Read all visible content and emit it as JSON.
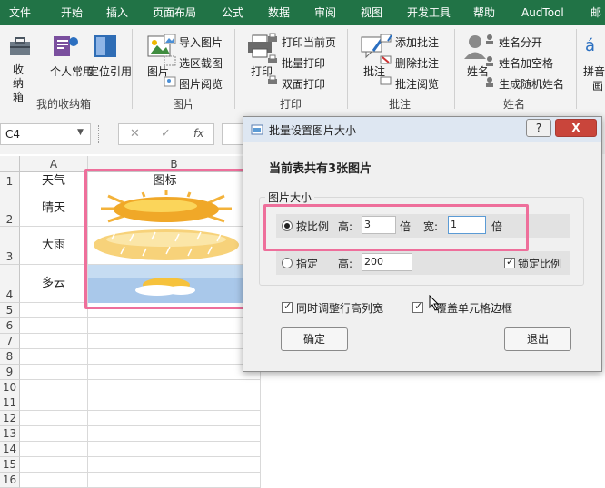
{
  "ribbon_tabs": [
    "文件",
    "开始",
    "插入",
    "页面布局",
    "公式",
    "数据",
    "审阅",
    "视图",
    "开发工具",
    "帮助",
    "AudTool",
    "邮"
  ],
  "ribbon": {
    "collect_box": "收纳箱",
    "personal": "个人常用",
    "locate_ref": "定位引用",
    "group_my_box": "我的收纳箱",
    "picture_btn": "图片",
    "import_picture": "导入图片",
    "area_screenshot": "选区截图",
    "picture_browse": "图片阅览",
    "group_picture": "图片",
    "print_btn": "打印",
    "print_current_page": "打印当前页",
    "batch_print": "批量打印",
    "duplex_print": "双面打印",
    "group_print": "打印",
    "comment_btn": "批注",
    "add_comment": "添加批注",
    "delete_comment": "删除批注",
    "comment_browse": "批注阅览",
    "group_comment": "批注",
    "name_btn": "姓名",
    "split_name": "姓名分开",
    "name_add_space": "姓名加空格",
    "random_name": "生成随机姓名",
    "group_name": "姓名",
    "pinyin": "拼音",
    "pinyin_sub": "画"
  },
  "formula_bar": {
    "name_box": "C4",
    "fx": "fx"
  },
  "sheet": {
    "columns": [
      "A",
      "B"
    ],
    "header_row": [
      "天气",
      "图标"
    ],
    "rows": [
      {
        "num": "1"
      },
      {
        "num": "2",
        "a": "晴天"
      },
      {
        "num": "3",
        "a": "大雨"
      },
      {
        "num": "4",
        "a": "多云"
      },
      {
        "num": "5"
      },
      {
        "num": "6"
      },
      {
        "num": "7"
      },
      {
        "num": "8"
      },
      {
        "num": "9"
      },
      {
        "num": "10"
      },
      {
        "num": "11"
      },
      {
        "num": "12"
      },
      {
        "num": "13"
      },
      {
        "num": "14"
      },
      {
        "num": "15"
      },
      {
        "num": "16"
      }
    ]
  },
  "dialog": {
    "title": "批量设置图片大小",
    "help_btn": "?",
    "close_btn": "X",
    "heading": "当前表共有3张图片",
    "group_title": "图片大小",
    "by_ratio": "按比例",
    "height_label": "高:",
    "height_ratio": "3",
    "times": "倍",
    "width_label": "宽:",
    "width_ratio": "1",
    "specify": "指定",
    "height_label2": "高:",
    "height_value": "200",
    "lock_ratio": "锁定比例",
    "adjust_rows_cols": "同时调整行高列宽",
    "cover_border": "覆盖单元格边框",
    "ok": "确定",
    "exit": "退出"
  }
}
